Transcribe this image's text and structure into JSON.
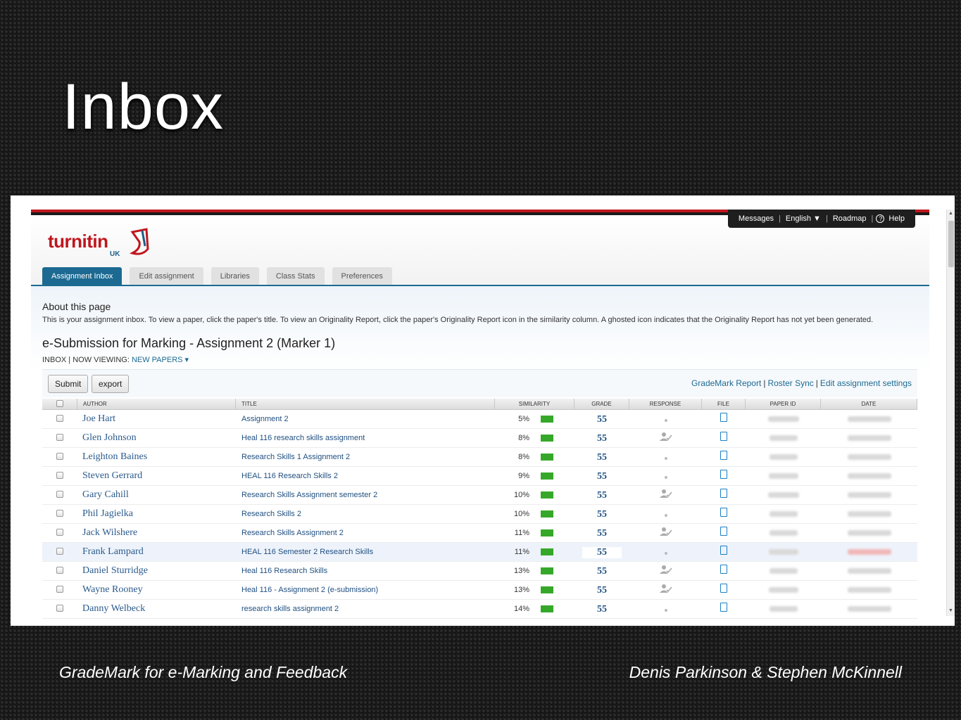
{
  "slide": {
    "title": "Inbox",
    "footer_left": "GradeMark for e-Marking and Feedback",
    "footer_right": "Denis Parkinson & Stephen McKinnell"
  },
  "topnav": {
    "messages": "Messages",
    "language": "English ▼",
    "roadmap": "Roadmap",
    "help": "Help"
  },
  "logo": {
    "text": "turnitin",
    "sub": "UK",
    "brand_color": "#c0161e"
  },
  "tabs": [
    {
      "label": "Assignment Inbox",
      "active": true
    },
    {
      "label": "Edit assignment"
    },
    {
      "label": "Libraries"
    },
    {
      "label": "Class Stats"
    },
    {
      "label": "Preferences"
    }
  ],
  "about": {
    "heading": "About this page",
    "text": "This is your assignment inbox. To view a paper, click the paper's title. To view an Originality Report, click the paper's Originality Report icon in the similarity column. A ghosted icon indicates that the Originality Report has not yet been generated."
  },
  "assignment": {
    "title": "e-Submission for Marking - Assignment 2 (Marker 1)",
    "crumb_inbox": "INBOX",
    "crumb_viewing": "| NOW VIEWING:",
    "crumb_filter": "NEW PAPERS ▾"
  },
  "toolbar": {
    "submit": "Submit",
    "export": "export",
    "grademark_report": "GradeMark Report",
    "roster_sync": "Roster Sync",
    "edit_settings": "Edit assignment settings",
    "separator": "|"
  },
  "table": {
    "headers": [
      "AUTHOR",
      "TITLE",
      "SIMILARITY",
      "GRADE",
      "RESPONSE",
      "FILE",
      "PAPER ID",
      "DATE"
    ],
    "accent_color": "#36a829",
    "rows": [
      {
        "author": "Joe Hart",
        "title": "Assignment 2",
        "similarity": "5%",
        "grade": "55",
        "response": "none"
      },
      {
        "author": "Glen Johnson",
        "title": "Heal 116 research skills assignment",
        "similarity": "8%",
        "grade": "55",
        "response": "viewed"
      },
      {
        "author": "Leighton Baines",
        "title": "Research Skills 1 Assignment 2",
        "similarity": "8%",
        "grade": "55",
        "response": "none"
      },
      {
        "author": "Steven Gerrard",
        "title": "HEAL 116 Research Skills 2",
        "similarity": "9%",
        "grade": "55",
        "response": "none"
      },
      {
        "author": "Gary Cahill",
        "title": "Research Skills Assignment semester 2",
        "similarity": "10%",
        "grade": "55",
        "response": "viewed"
      },
      {
        "author": "Phil Jagielka",
        "title": "Research Skills 2",
        "similarity": "10%",
        "grade": "55",
        "response": "none"
      },
      {
        "author": "Jack Wilshere",
        "title": "Research Skills Assignment 2",
        "similarity": "11%",
        "grade": "55",
        "response": "viewed"
      },
      {
        "author": "Frank Lampard",
        "title": "HEAL 116 Semester 2 Research Skills",
        "similarity": "11%",
        "grade": "55",
        "response": "none",
        "highlight": true
      },
      {
        "author": "Daniel Sturridge",
        "title": "Heal 116 Research Skills",
        "similarity": "13%",
        "grade": "55",
        "response": "viewed"
      },
      {
        "author": "Wayne Rooney",
        "title": "Heal 116 - Assignment 2 (e-submission)",
        "similarity": "13%",
        "grade": "55",
        "response": "viewed"
      },
      {
        "author": "Danny Welbeck",
        "title": "research skills assignment 2",
        "similarity": "14%",
        "grade": "55",
        "response": "none"
      }
    ]
  }
}
